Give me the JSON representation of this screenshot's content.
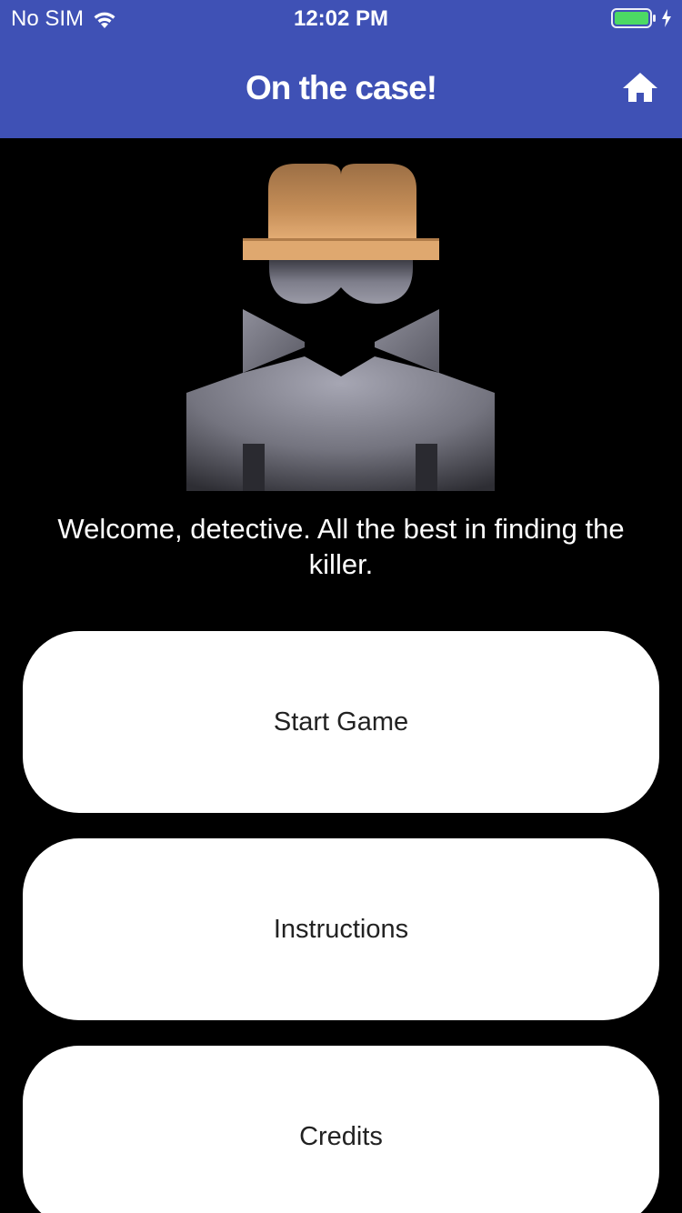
{
  "status_bar": {
    "carrier": "No SIM",
    "time": "12:02 PM",
    "wifi_icon": "wifi-icon",
    "battery_icon": "battery-icon",
    "charging_icon": "bolt-icon",
    "battery_color": "#4CD964"
  },
  "header": {
    "title": "On the case!",
    "home_icon": "home-icon",
    "background": "#3F51B5"
  },
  "hero": {
    "illustration": "detective-silhouette-icon"
  },
  "welcome_text": "Welcome, detective. All the best in finding the killer.",
  "menu": {
    "start_label": "Start Game",
    "instructions_label": "Instructions",
    "credits_label": "Credits"
  }
}
